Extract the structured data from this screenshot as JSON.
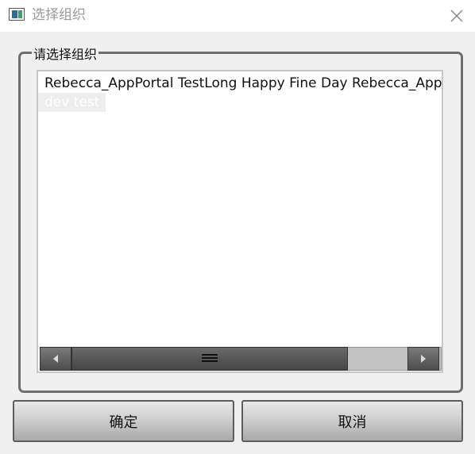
{
  "window": {
    "title": "选择组织",
    "icon": "window-icon",
    "close_icon": "close-icon"
  },
  "group": {
    "label": "请选择组织",
    "items": [
      {
        "label": "Rebecca_AppPortal TestLong Happy Fine Day Rebecca_AppPortal TestLong Happy Fine Day",
        "selected": false
      },
      {
        "label": "dev test",
        "selected": true
      }
    ]
  },
  "scrollbar": {
    "left_icon": "arrow-left-icon",
    "right_icon": "arrow-right-icon",
    "grip_icon": "grip-icon"
  },
  "buttons": {
    "ok": "确定",
    "cancel": "取消"
  },
  "colors": {
    "background": "#f0f0f0",
    "selection": "#eeeeee",
    "border": "#6e6e6e"
  }
}
